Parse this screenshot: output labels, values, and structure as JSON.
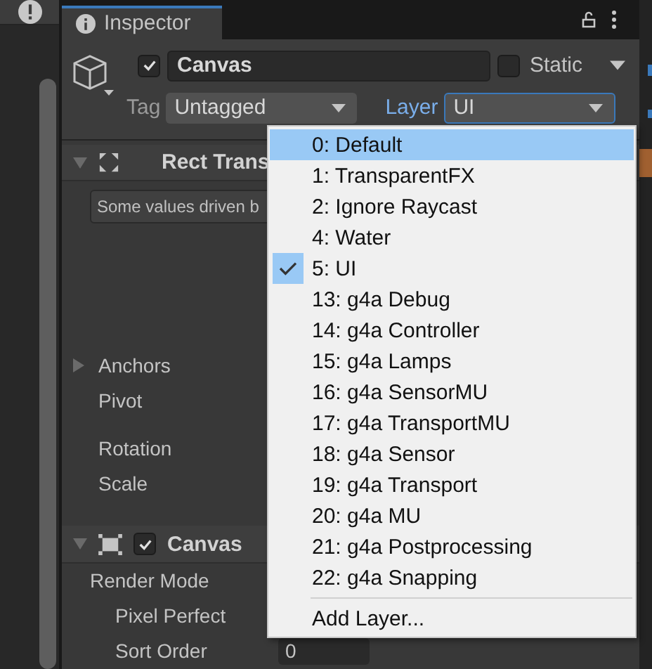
{
  "inspector": {
    "tab": "Inspector",
    "object": {
      "active": true,
      "name": "Canvas",
      "static": false,
      "static_label": "Static",
      "tag_label": "Tag",
      "tag": "Untagged",
      "layer_label": "Layer",
      "layer": "UI"
    },
    "rect_transform": {
      "title": "Rect Trans",
      "expanded": true,
      "info": "Some values driven b",
      "fields": [
        "Anchors",
        "Pivot",
        "Rotation",
        "Scale"
      ]
    },
    "canvas": {
      "title": "Canvas",
      "expanded": true,
      "enabled": true,
      "fields": [
        {
          "label": "Render Mode",
          "indented": false
        },
        {
          "label": "Pixel Perfect",
          "indented": true
        },
        {
          "label": "Sort Order",
          "indented": true,
          "value": "0"
        }
      ]
    }
  },
  "layer_menu": {
    "items": [
      {
        "label": "0: Default",
        "checked": false,
        "highlighted": true
      },
      {
        "label": "1: TransparentFX",
        "checked": false,
        "highlighted": false
      },
      {
        "label": "2: Ignore Raycast",
        "checked": false,
        "highlighted": false
      },
      {
        "label": "4: Water",
        "checked": false,
        "highlighted": false
      },
      {
        "label": "5: UI",
        "checked": true,
        "highlighted": false
      },
      {
        "label": "13: g4a Debug",
        "checked": false,
        "highlighted": false
      },
      {
        "label": "14: g4a Controller",
        "checked": false,
        "highlighted": false
      },
      {
        "label": "15: g4a Lamps",
        "checked": false,
        "highlighted": false
      },
      {
        "label": "16: g4a SensorMU",
        "checked": false,
        "highlighted": false
      },
      {
        "label": "17: g4a TransportMU",
        "checked": false,
        "highlighted": false
      },
      {
        "label": "18: g4a Sensor",
        "checked": false,
        "highlighted": false
      },
      {
        "label": "19: g4a Transport",
        "checked": false,
        "highlighted": false
      },
      {
        "label": "20: g4a MU",
        "checked": false,
        "highlighted": false
      },
      {
        "label": "21: g4a Postprocessing",
        "checked": false,
        "highlighted": false
      },
      {
        "label": "22: g4a Snapping",
        "checked": false,
        "highlighted": false
      }
    ],
    "action": "Add Layer..."
  }
}
